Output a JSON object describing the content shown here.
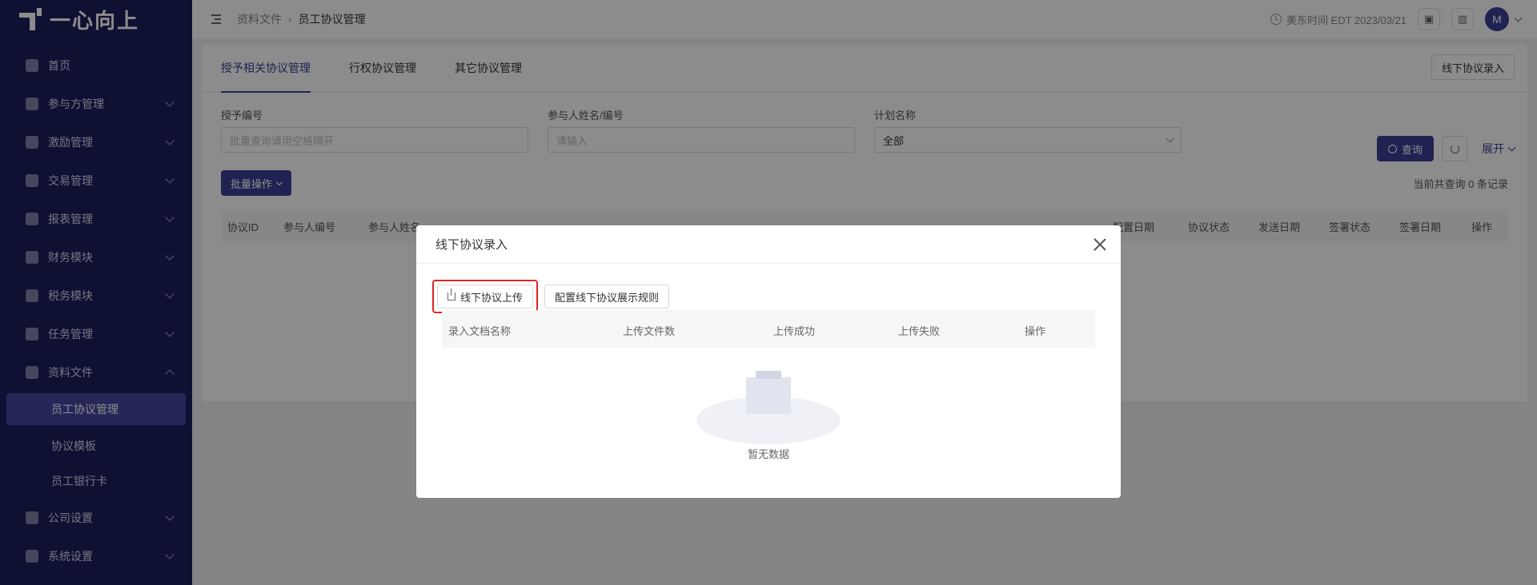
{
  "sidebar": {
    "logo_text": "一心向上",
    "items": [
      {
        "label": "首页",
        "icon": "home-icon",
        "chevron": false
      },
      {
        "label": "参与方管理",
        "icon": "participants-icon",
        "chevron": true
      },
      {
        "label": "激励管理",
        "icon": "incentive-icon",
        "chevron": true
      },
      {
        "label": "交易管理",
        "icon": "trade-icon",
        "chevron": true
      },
      {
        "label": "报表管理",
        "icon": "report-icon",
        "chevron": true
      },
      {
        "label": "财务模块",
        "icon": "finance-icon",
        "chevron": true
      },
      {
        "label": "税务模块",
        "icon": "tax-icon",
        "chevron": true
      },
      {
        "label": "任务管理",
        "icon": "task-icon",
        "chevron": true
      },
      {
        "label": "资料文件",
        "icon": "folder-icon",
        "chevron": true,
        "expanded": true
      }
    ],
    "sub_items": [
      "员工协议管理",
      "协议模板",
      "员工银行卡"
    ],
    "bottom_items": [
      {
        "label": "公司设置",
        "icon": "company-icon"
      },
      {
        "label": "系统设置",
        "icon": "settings-icon"
      }
    ]
  },
  "header": {
    "breadcrumb": [
      "资料文件",
      "员工协议管理"
    ],
    "timezone": "美东时间 EDT 2023/03/21",
    "avatar_letter": "M"
  },
  "main": {
    "tabs": [
      "授予相关协议管理",
      "行权协议管理",
      "其它协议管理"
    ],
    "active_tab": 0,
    "offline_entry_button": "线下协议录入",
    "filters": [
      {
        "label": "授予编号",
        "placeholder": "批量查询请用空格隔开"
      },
      {
        "label": "参与人姓名/编号",
        "placeholder": "请输入"
      },
      {
        "label": "计划名称",
        "value": "全部"
      }
    ],
    "search_button": "查询",
    "expand_label": "展开",
    "batch_button": "批量操作",
    "record_count": "当前共查询 0 条记录",
    "columns": [
      "协议ID",
      "参与人编号",
      "参与人姓名",
      "配置日期",
      "协议状态",
      "发送日期",
      "签署状态",
      "签署日期",
      "操作"
    ]
  },
  "modal": {
    "title": "线下协议录入",
    "upload_button": "线下协议上传",
    "config_button": "配置线下协议展示规则",
    "columns": [
      "录入文档名称",
      "上传文件数",
      "上传成功",
      "上传失败",
      "操作"
    ],
    "empty_text": "暂无数据"
  },
  "colors": {
    "sidebar_bg": "#1d1f5e",
    "primary": "#3b3e95",
    "highlight": "#e02424"
  }
}
